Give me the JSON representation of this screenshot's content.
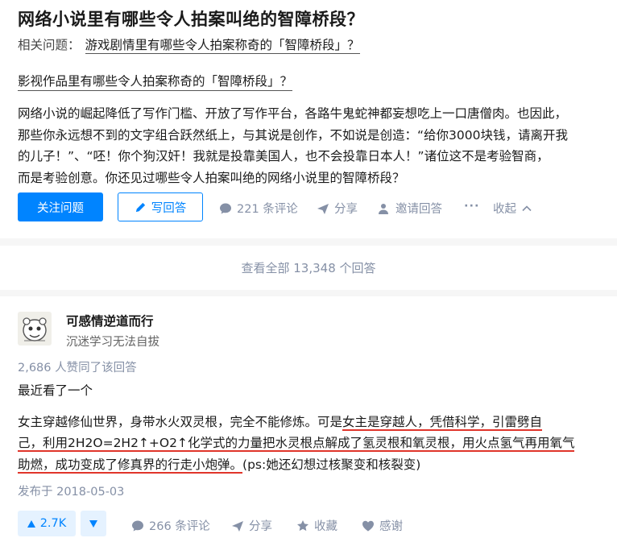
{
  "question": {
    "title": "网络小说里有哪些令人拍案叫绝的智障桥段？",
    "related_label": "相关问题：",
    "related_1": "游戏剧情里有哪些令人拍案称奇的「智障桥段」？",
    "related_2": "影视作品里有哪些令人拍案称奇的「智障桥段」？",
    "description_lines": [
      "网络小说的崛起降低了写作门槛、开放了写作平台，各路牛鬼蛇神都妄想吃上一口唐僧肉。也因此，",
      "那些你永远想不到的文字组合跃然纸上，与其说是创作，不如说是创造：“给你3000块钱，请离开我",
      "的儿子！”、“呸！你个狗汉奸！我就是投靠美国人，也不会投靠日本人！”诸位这不是考验智商，",
      "而是考验创意。你还见过哪些令人拍案叫绝的网络小说里的智障桥段？"
    ],
    "follow_button": "关注问题",
    "write_button": "写回答",
    "comments": "221 条评论",
    "share": "分享",
    "invite": "邀请回答",
    "more": "···",
    "collapse": "收起"
  },
  "view_all": "查看全部 13,348 个回答",
  "answer": {
    "author": "可感情逆道而行",
    "headline": "沉迷学习无法自拔",
    "voters": "2,686 人赞同了该回答",
    "intro": "最近看了一个",
    "p2_line1_a": "女主穿越修仙世界，身带水火双灵根，完全不能修炼。可是",
    "p2_line1_b": "女主是穿越人，凭借科学，引雷劈自",
    "p2_line2": "己，利用2H2O=2H2↑+O2↑化学式的力量把水灵根点解成了氢灵根和氧灵根，用火点氢气再用氧气",
    "p2_line3_a": "助燃，成功变成了修真界的行走小炮弹。",
    "p2_line3_b": "(ps:她还幻想过核聚变和核裂变)",
    "date": "发布于 2018-05-03",
    "vote_count": "2.7K",
    "comments": "266 条评论",
    "share": "分享",
    "favorite": "收藏",
    "thanks": "感谢"
  },
  "colors": {
    "accent": "#0084ff",
    "highlight": "#e0352b",
    "muted": "#8590a6"
  }
}
